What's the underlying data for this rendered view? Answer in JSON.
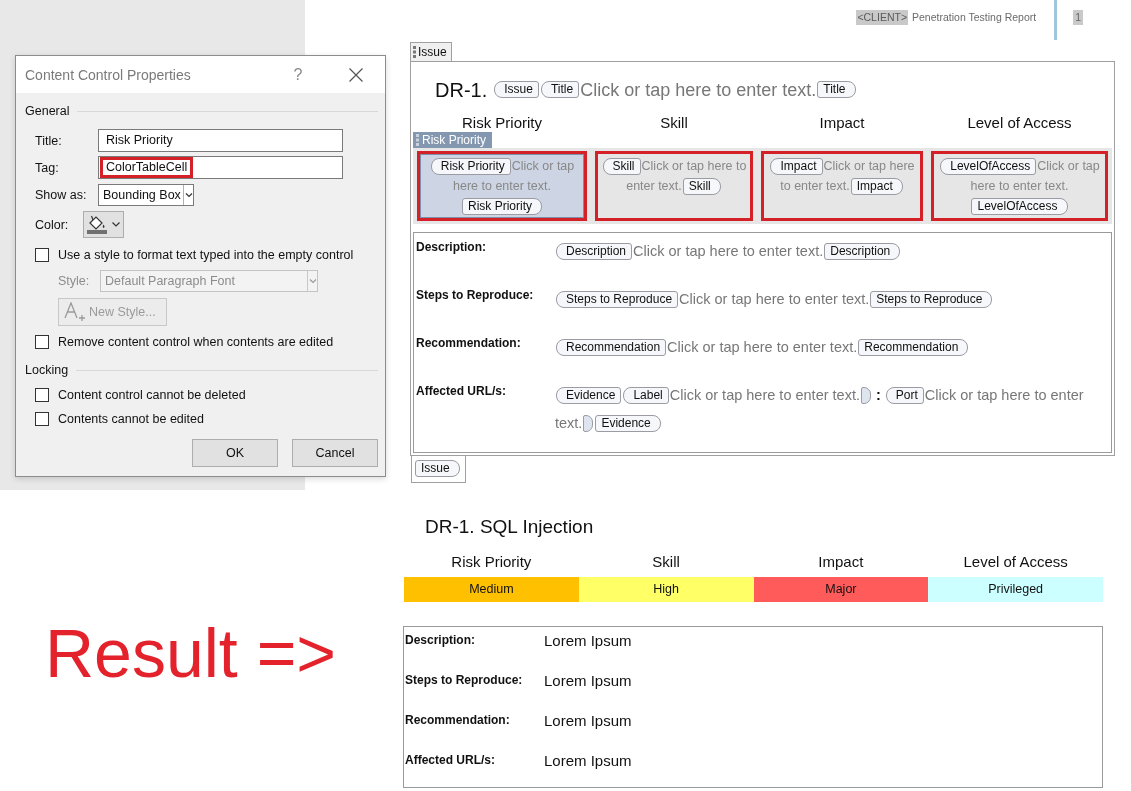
{
  "dialog": {
    "title": "Content Control Properties",
    "help_label": "?",
    "general_heading": "General",
    "fields": [
      {
        "label": "Title:",
        "value": "Risk Priority",
        "highlighted": false
      },
      {
        "label": "Tag:",
        "value": "ColorTableCell",
        "highlighted": true
      }
    ],
    "show_as": {
      "label": "Show as:",
      "value": "Bounding Box"
    },
    "color": {
      "label": "Color:"
    },
    "use_style": {
      "label": "Use a style to format text typed into the empty control",
      "checked": false
    },
    "style": {
      "label": "Style:",
      "value": "Default Paragraph Font",
      "disabled": true
    },
    "new_style_button": {
      "label": "New Style...",
      "disabled": true
    },
    "remove_when_edited": {
      "label": "Remove content control when contents are edited",
      "checked": false
    },
    "locking_heading": "Locking",
    "locking_options": [
      {
        "label": "Content control cannot be deleted",
        "checked": false
      },
      {
        "label": "Contents cannot be edited",
        "checked": false
      }
    ],
    "buttons": [
      "OK",
      "Cancel"
    ]
  },
  "page_header": {
    "client_placeholder": "<CLIENT>",
    "report_title": "Penetration Testing Report",
    "page_number": "1"
  },
  "template": {
    "start_tag": "Issue",
    "heading": [
      {
        "kind": "text",
        "text": "DR-1."
      },
      {
        "kind": "start_tag",
        "text": "Issue"
      },
      {
        "kind": "start_tag",
        "text": "Title"
      },
      {
        "kind": "placeholder",
        "text": "Click or tap here to enter text."
      },
      {
        "kind": "end_tag",
        "text": "Title"
      }
    ],
    "columns": [
      {
        "header": "Risk Priority",
        "selected": true,
        "title_tab": "Risk Priority",
        "highlighted": true,
        "parts": [
          {
            "kind": "start_tag",
            "text": "Risk Priority"
          },
          {
            "kind": "placeholder",
            "text": "Click or tap here to enter text."
          },
          {
            "kind": "end_tag",
            "text": "Risk Priority"
          }
        ]
      },
      {
        "header": "Skill",
        "selected": false,
        "highlighted": true,
        "parts": [
          {
            "kind": "start_tag",
            "text": "Skill"
          },
          {
            "kind": "placeholder",
            "text": "Click or tap here to enter text."
          },
          {
            "kind": "end_tag",
            "text": "Skill"
          }
        ]
      },
      {
        "header": "Impact",
        "selected": false,
        "highlighted": true,
        "parts": [
          {
            "kind": "start_tag",
            "text": "Impact"
          },
          {
            "kind": "placeholder",
            "text": "Click or tap here to enter text."
          },
          {
            "kind": "end_tag",
            "text": "Impact"
          }
        ]
      },
      {
        "header": "Level of Access",
        "selected": false,
        "highlighted": true,
        "parts": [
          {
            "kind": "start_tag",
            "text": "LevelOfAccess"
          },
          {
            "kind": "placeholder",
            "text": "Click or tap here to enter text."
          },
          {
            "kind": "end_tag",
            "text": "LevelOfAccess"
          }
        ]
      }
    ],
    "details": [
      {
        "label": "Description:",
        "parts": [
          {
            "kind": "start_tag",
            "text": "Description"
          },
          {
            "kind": "placeholder",
            "text": "Click or tap here to enter text."
          },
          {
            "kind": "end_tag",
            "text": "Description"
          }
        ]
      },
      {
        "label": "Steps to Reproduce:",
        "parts": [
          {
            "kind": "start_tag",
            "text": "Steps to Reproduce"
          },
          {
            "kind": "placeholder",
            "text": "Click or tap here to enter text."
          },
          {
            "kind": "end_tag",
            "text": "Steps to Reproduce"
          }
        ]
      },
      {
        "label": "Recommendation:",
        "parts": [
          {
            "kind": "start_tag",
            "text": "Recommendation"
          },
          {
            "kind": "placeholder",
            "text": "Click or tap here to enter text."
          },
          {
            "kind": "end_tag",
            "text": "Recommendation"
          }
        ]
      },
      {
        "label": "Affected URL/s:",
        "parts": [
          {
            "kind": "start_tag",
            "text": "Evidence"
          },
          {
            "kind": "start_tag",
            "text": "Label"
          },
          {
            "kind": "placeholder",
            "text": "Click or tap here to enter text."
          },
          {
            "kind": "empty_end_tag"
          },
          {
            "kind": "text",
            "text": ":"
          },
          {
            "kind": "start_tag",
            "text": "Port"
          },
          {
            "kind": "placeholder",
            "text": "Click or tap here to enter text."
          },
          {
            "kind": "empty_end_tag"
          },
          {
            "kind": "end_tag",
            "text": "Evidence"
          }
        ]
      }
    ],
    "end_tag": "Issue"
  },
  "result_label": "Result =>",
  "rendered_issue": {
    "title": "DR-1. SQL Injection",
    "ratings": [
      {
        "header": "Risk Priority",
        "value": "Medium",
        "color": "#ffc000"
      },
      {
        "header": "Skill",
        "value": "High",
        "color": "#ffff66"
      },
      {
        "header": "Impact",
        "value": "Major",
        "color": "#ff5b5b"
      },
      {
        "header": "Level of Access",
        "value": "Privileged",
        "color": "#ccffff"
      }
    ],
    "details": [
      {
        "label": "Description:",
        "value": "Lorem Ipsum"
      },
      {
        "label": "Steps to Reproduce:",
        "value": "Lorem Ipsum"
      },
      {
        "label": "Recommendation:",
        "value": "Lorem Ipsum"
      },
      {
        "label": "Affected URL/s:",
        "value": "Lorem Ipsum"
      }
    ]
  }
}
